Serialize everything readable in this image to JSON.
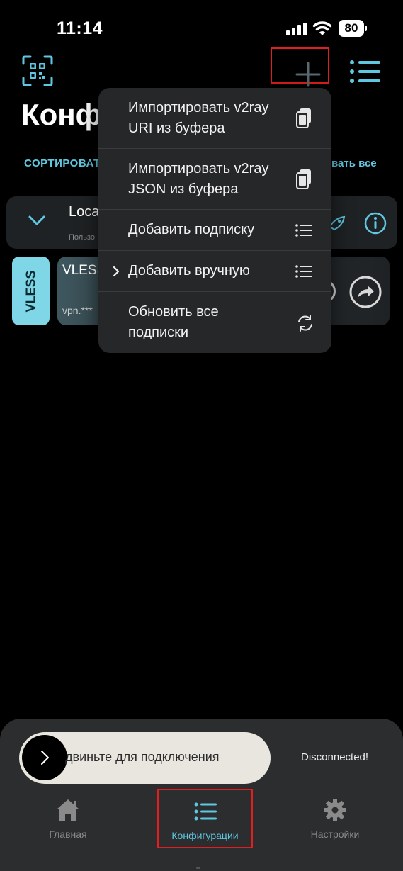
{
  "status_bar": {
    "time": "11:14",
    "battery": "80"
  },
  "header": {
    "title": "Конф"
  },
  "toolbar": {
    "sort_label": "СОРТИРОВАТ",
    "select_all_label": "вать все"
  },
  "group": {
    "name": "Loca",
    "subtitle": "Пользо"
  },
  "config": {
    "protocol": "VLESS",
    "name": "VLESS",
    "host": "vpn.***"
  },
  "dropdown": {
    "items": [
      {
        "line1": "Импортировать v2ray",
        "line2": "URI из буфера",
        "icon": "clipboard-icon"
      },
      {
        "line1": "Импортировать v2ray",
        "line2": "JSON из буфера",
        "icon": "clipboard-icon"
      },
      {
        "line1": "Добавить подписку",
        "line2": "",
        "icon": "list-icon"
      },
      {
        "line1": "Добавить вручную",
        "line2": "",
        "icon": "list-icon",
        "has_chevron": true
      },
      {
        "line1": "Обновить все",
        "line2": "подписки",
        "icon": "refresh-icon"
      }
    ]
  },
  "connect": {
    "slider_text": "двиньте для подключения",
    "status": "Disconnected!"
  },
  "nav": {
    "home": "Главная",
    "configs": "Конфигурации",
    "settings": "Настройки"
  },
  "colors": {
    "accent": "#5fc8e0",
    "highlight_box": "#e21e1e",
    "background": "#000000",
    "menu_bg": "#262729"
  }
}
